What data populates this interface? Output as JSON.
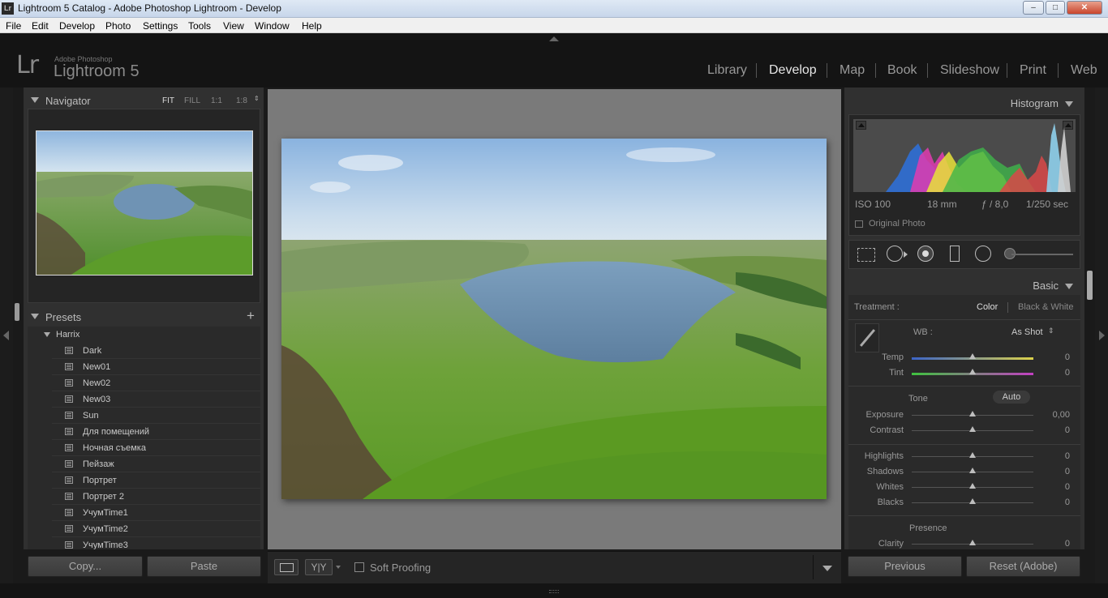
{
  "window": {
    "title": "Lightroom 5 Catalog - Adobe Photoshop Lightroom - Develop",
    "app_icon": "Lr",
    "controls": [
      "minimize-icon",
      "maximize-icon",
      "close-icon"
    ]
  },
  "menu": [
    "File",
    "Edit",
    "Develop",
    "Photo",
    "Settings",
    "Tools",
    "View",
    "Window",
    "Help"
  ],
  "identity": {
    "logo": "Lr",
    "vendor": "Adobe Photoshop",
    "product": "Lightroom 5"
  },
  "modules": [
    {
      "label": "Library",
      "active": false
    },
    {
      "label": "Develop",
      "active": true
    },
    {
      "label": "Map",
      "active": false
    },
    {
      "label": "Book",
      "active": false
    },
    {
      "label": "Slideshow",
      "active": false
    },
    {
      "label": "Print",
      "active": false
    },
    {
      "label": "Web",
      "active": false
    }
  ],
  "navigator": {
    "title": "Navigator",
    "options": [
      "FIT",
      "FILL",
      "1:1",
      "1:8"
    ],
    "active_option": "FIT"
  },
  "presets": {
    "title": "Presets",
    "add_symbol": "+",
    "folder": "Harrix",
    "items": [
      "Dark",
      "New01",
      "New02",
      "New03",
      "Sun",
      "Для помещений",
      "Ночная съемка",
      "Пейзаж",
      "Портрет",
      "Портрет 2",
      "УчумTime1",
      "УчумTime2",
      "УчумTime3"
    ]
  },
  "left_buttons": {
    "copy": "Copy...",
    "paste": "Paste"
  },
  "toolbar": {
    "soft_proofing": "Soft Proofing",
    "compare_icon": "Y|Y"
  },
  "histogram": {
    "title": "Histogram",
    "iso": "ISO 100",
    "focal": "18 mm",
    "aperture": "ƒ / 8,0",
    "shutter": "1/250 sec",
    "original_photo": "Original Photo"
  },
  "basic": {
    "title": "Basic",
    "treatment_label": "Treatment :",
    "treatment_color": "Color",
    "treatment_bw": "Black & White",
    "wb_label": "WB :",
    "wb_value": "As Shot",
    "tone_label": "Tone",
    "auto_label": "Auto",
    "presence_label": "Presence",
    "sliders": [
      {
        "label": "Temp",
        "value": "0"
      },
      {
        "label": "Tint",
        "value": "0"
      },
      {
        "label": "Exposure",
        "value": "0,00"
      },
      {
        "label": "Contrast",
        "value": "0"
      },
      {
        "label": "Highlights",
        "value": "0"
      },
      {
        "label": "Shadows",
        "value": "0"
      },
      {
        "label": "Whites",
        "value": "0"
      },
      {
        "label": "Blacks",
        "value": "0"
      },
      {
        "label": "Clarity",
        "value": "0"
      }
    ]
  },
  "right_buttons": {
    "previous": "Previous",
    "reset": "Reset (Adobe)"
  }
}
